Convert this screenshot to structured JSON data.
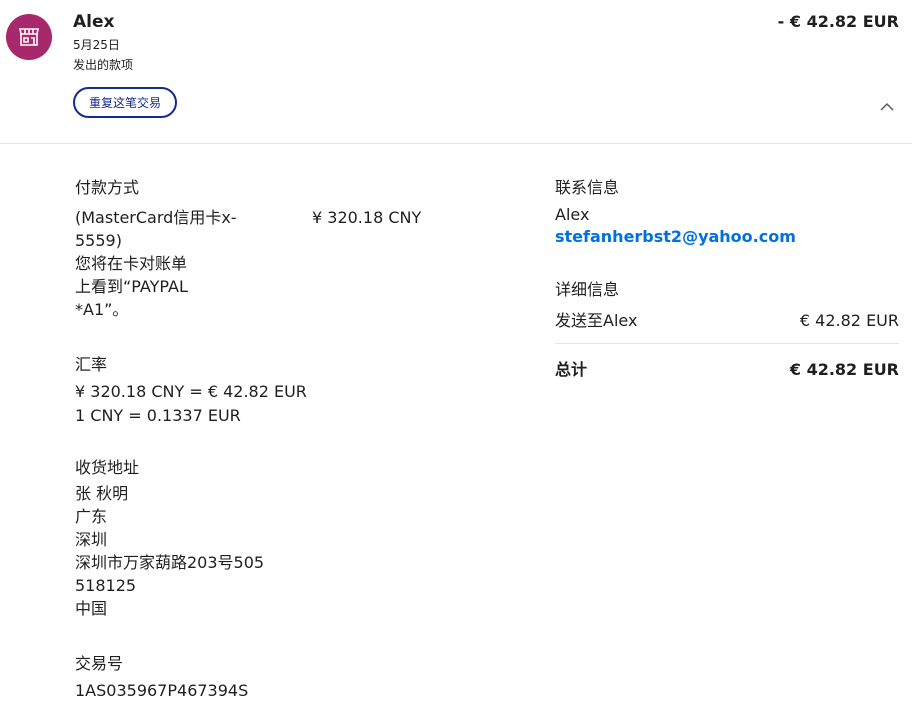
{
  "header": {
    "name": "Alex",
    "date": "5月25日",
    "type": "发出的款项",
    "amount": "- € 42.82 EUR",
    "repeat_button": "重复这笔交易",
    "avatar_icon": "store-icon",
    "avatar_color": "#a8286c",
    "collapse_icon": "chevron-up-icon"
  },
  "payment": {
    "label": "付款方式",
    "card_lines": [
      "(MasterCard信用卡x-",
      "5559)",
      "您将在卡对账单",
      "上看到“PAYPAL",
      "*A1”。"
    ],
    "amount": "¥ 320.18 CNY"
  },
  "exchange": {
    "label": "汇率",
    "line1": "¥ 320.18 CNY = € 42.82 EUR",
    "line2": "1 CNY = 0.1337 EUR"
  },
  "shipping": {
    "label": "收货地址",
    "lines": [
      "张 秋明",
      "广东",
      "深圳",
      "深圳市万家葫路203号505",
      "518125",
      "中国"
    ]
  },
  "transaction": {
    "label": "交易号",
    "id": "1AS035967P467394S"
  },
  "contact": {
    "label": "联系信息",
    "name": "Alex",
    "email": "stefanherbst2@yahoo.com"
  },
  "details": {
    "label": "详细信息",
    "sent_to": "发送至Alex",
    "sent_amount": "€ 42.82 EUR",
    "total_label": "总计",
    "total_amount": "€ 42.82 EUR"
  },
  "colors": {
    "button_border": "#142c8e",
    "link": "#0070e0"
  }
}
